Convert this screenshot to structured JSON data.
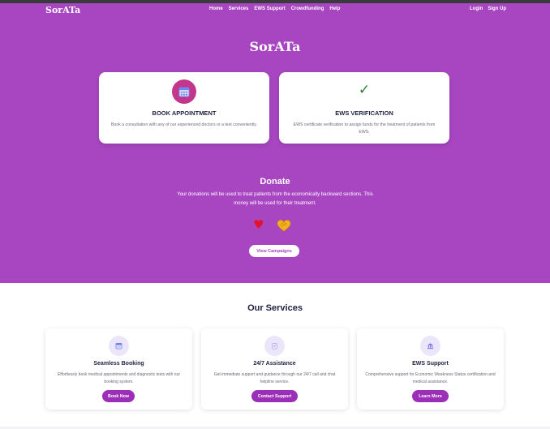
{
  "nav": {
    "brand": "SorATa",
    "links": [
      "Home",
      "Services",
      "EWS Support",
      "Crowdfunding",
      "Help"
    ],
    "login": "Login",
    "signup": "Sign Up"
  },
  "hero": {
    "title": "SorATa",
    "cards": [
      {
        "icon": "calendar-icon",
        "title": "BOOK APPOINTMENT",
        "description": "Book a consultation with any of our experienced doctors or a test conveniently."
      },
      {
        "icon": "checkmark-icon",
        "title": "EWS VERIFICATION",
        "description": "EWS certificate verification to assign funds for the treatment of patients from EWS."
      }
    ]
  },
  "donate": {
    "title": "Donate",
    "description": "Your donations will be used to treat patients from the economically backward sections. This money will be used for their treatment.",
    "button": "View Campaigns"
  },
  "services": {
    "title": "Our Services",
    "items": [
      {
        "icon": "calendar-icon",
        "title": "Seamless Booking",
        "description": "Effortlessly book medical appointments and diagnostic tests with our booking system.",
        "button": "Book Now"
      },
      {
        "icon": "clipboard-icon",
        "title": "24/7 Assistance",
        "description": "Get immediate support and guidance through our 24/7 call and chat helpline service.",
        "button": "Contact Support"
      },
      {
        "icon": "bank-icon",
        "title": "EWS Support",
        "description": "Comprehensive support for Economic Weakness Status certification and medical assistance.",
        "button": "Learn More"
      }
    ]
  },
  "colors": {
    "hero_bg": "#a846c2",
    "button_bg": "#9c2fb8",
    "heading": "#1f2240"
  }
}
